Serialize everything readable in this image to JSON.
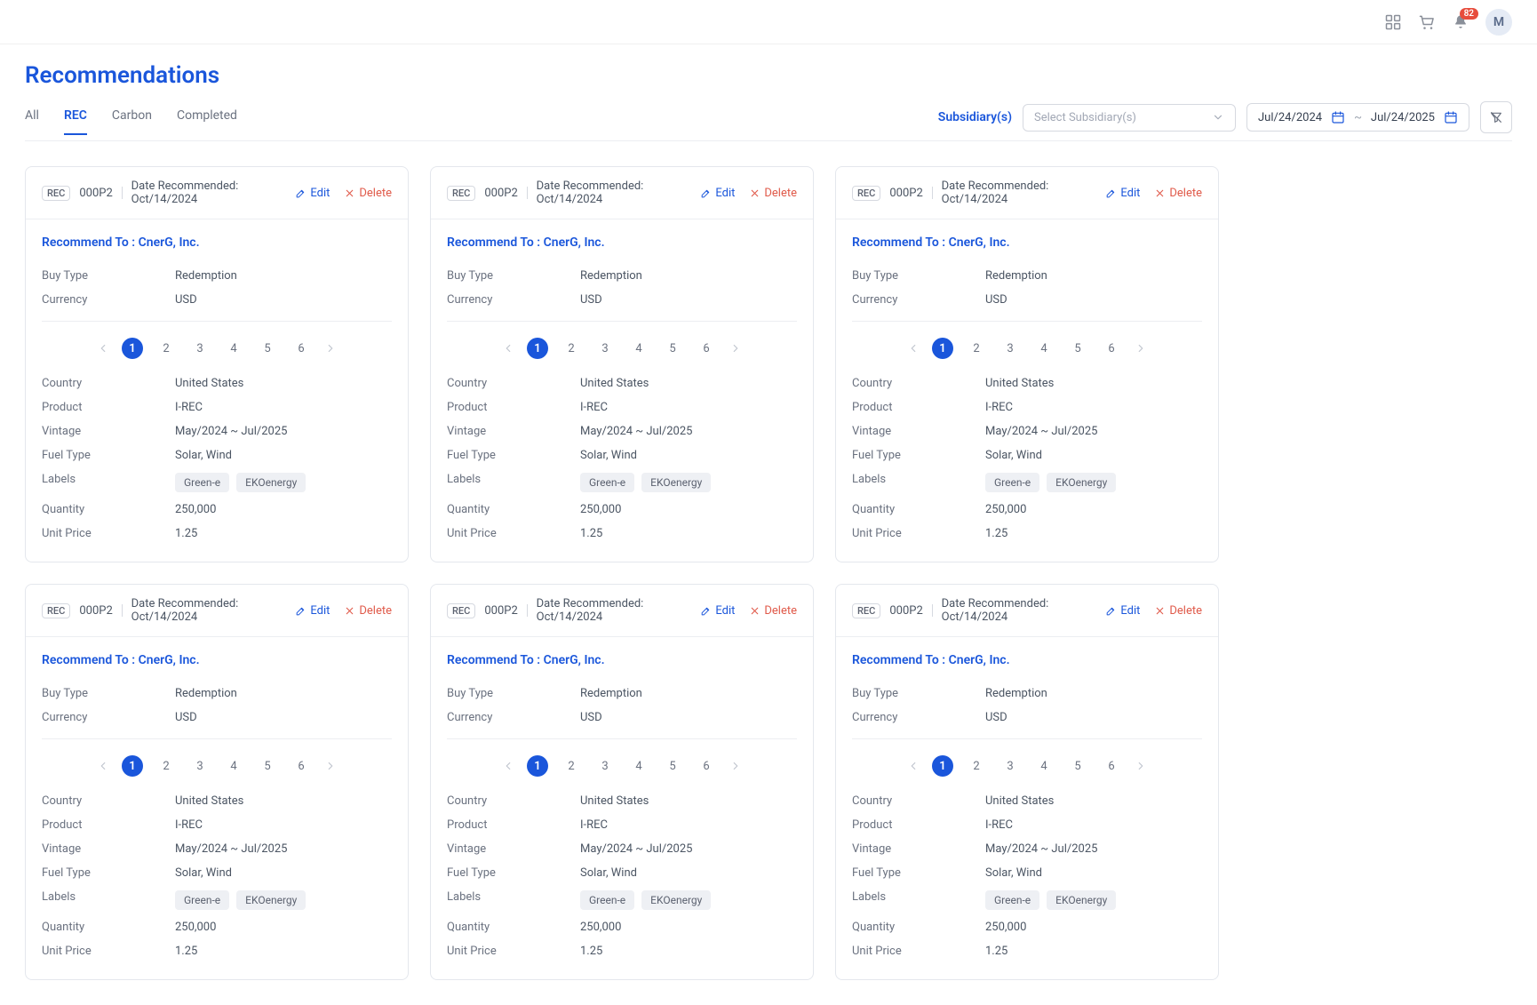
{
  "topbar": {
    "notification_count": "82",
    "avatar_initial": "M"
  },
  "page": {
    "title": "Recommendations"
  },
  "tabs": {
    "all": "All",
    "rec": "REC",
    "carbon": "Carbon",
    "completed": "Completed"
  },
  "filters": {
    "subsidiary_label": "Subsidiary(s)",
    "subsidiary_placeholder": "Select Subsidiary(s)",
    "date_from": "Jul/24/2024",
    "date_to": "Jul/24/2025"
  },
  "card_template": {
    "rec_tag": "REC",
    "code": "000P2",
    "date_recommended_label": "Date Recommended:",
    "date_recommended_value": "Oct/14/2024",
    "edit_label": "Edit",
    "delete_label": "Delete",
    "recommend_to_label": "Recommend To :",
    "recommend_to_value": "CnerG, Inc.",
    "fields": {
      "buy_type_label": "Buy Type",
      "buy_type_value": "Redemption",
      "currency_label": "Currency",
      "currency_value": "USD",
      "country_label": "Country",
      "country_value": "United States",
      "product_label": "Product",
      "product_value": "I-REC",
      "vintage_label": "Vintage",
      "vintage_value": "May/2024 ~ Jul/2025",
      "fuel_type_label": "Fuel Type",
      "fuel_type_value": "Solar, Wind",
      "labels_label": "Labels",
      "labels_chip_1": "Green-e",
      "labels_chip_2": "EKOenergy",
      "quantity_label": "Quantity",
      "quantity_value": "250,000",
      "unit_price_label": "Unit Price",
      "unit_price_value": "1.25"
    },
    "pager": {
      "p1": "1",
      "p2": "2",
      "p3": "3",
      "p4": "4",
      "p5": "5",
      "p6": "6"
    }
  }
}
